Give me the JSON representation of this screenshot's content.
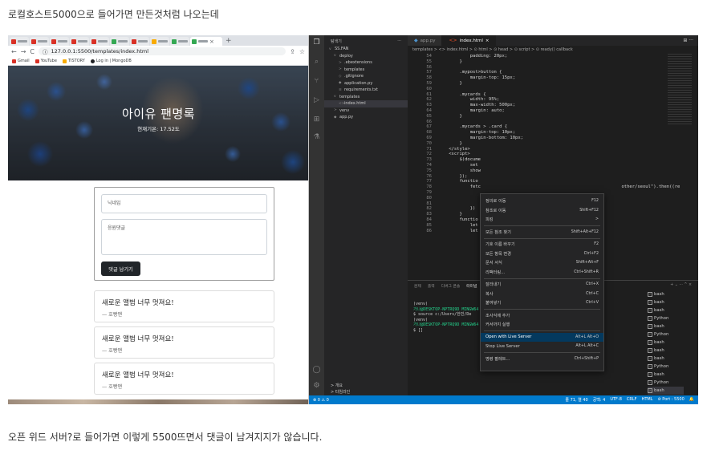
{
  "post": {
    "top_text": "로컬호스트5000으로 들어가면 만든것처럼 나오는데",
    "bottom_text": "오픈 위드 서버?로 들어가면 이렇게 5500뜨면서 댓글이 남겨지지가 않습니다."
  },
  "browser": {
    "tab_new": "+",
    "tab_close": "×",
    "url": "127.0.0.1:5500/templates/index.html",
    "nav": {
      "back": "←",
      "forward": "→",
      "reload": "C",
      "info": "ⓘ"
    },
    "bookmarks": [
      {
        "label": "Gmail",
        "icon": "red"
      },
      {
        "label": "YouTube",
        "icon": "red"
      },
      {
        "label": "TISTORY",
        "icon": "text"
      },
      {
        "label": "Log in | MongoDB",
        "icon": "black"
      }
    ],
    "page": {
      "title": "아이유 팬명록",
      "temperature": "현재기온: 17.52도",
      "name_placeholder": "닉네임",
      "comment_placeholder": "응원댓글",
      "submit_label": "댓글 남기기",
      "comments": [
        {
          "text": "새로운 앨범 너무 멋져요!",
          "author": "— 호빵맨"
        },
        {
          "text": "새로운 앨범 너무 멋져요!",
          "author": "— 호빵맨"
        },
        {
          "text": "새로운 앨범 너무 멋져요!",
          "author": "— 호빵맨"
        }
      ]
    }
  },
  "vscode": {
    "explorer_title": "탐색기",
    "explorer_more": "···",
    "tree": [
      {
        "label": "SS.FAN",
        "icon": "v",
        "indent": 0
      },
      {
        "label": "deploy",
        "icon": "v",
        "indent": 1
      },
      {
        "label": ".ebextensions",
        "icon": ">",
        "indent": 2
      },
      {
        "label": "templates",
        "icon": ">",
        "indent": 2
      },
      {
        "label": ".gitignore",
        "icon": "◇",
        "indent": 2
      },
      {
        "label": "application.py",
        "icon": "◆",
        "indent": 2
      },
      {
        "label": "requirements.txt",
        "icon": "≡",
        "indent": 2
      },
      {
        "label": "templates",
        "icon": "v",
        "indent": 1
      },
      {
        "label": "index.html",
        "icon": "<>",
        "indent": 2,
        "selected": true
      },
      {
        "label": "venv",
        "icon": ">",
        "indent": 1
      },
      {
        "label": "app.py",
        "icon": "◆",
        "indent": 1
      }
    ],
    "sidebar_bottom": [
      "> 개요",
      "> 타임라인"
    ],
    "tabs": [
      {
        "label": "app.py",
        "active": false
      },
      {
        "label": "index.html",
        "active": true
      }
    ],
    "tab_close": "×",
    "editor_actions": "⊞  ···",
    "breadcrumb": "templates > <> index.html > ⊙ html > ⊙ head > ⊙ script > ⊙ ready() callback",
    "code_lines": [
      {
        "n": "54",
        "t": "            padding: 20px;"
      },
      {
        "n": "55",
        "t": "        }"
      },
      {
        "n": "56",
        "t": ""
      },
      {
        "n": "57",
        "t": "        .mypost>button {"
      },
      {
        "n": "58",
        "t": "            margin-top: 15px;"
      },
      {
        "n": "59",
        "t": "        }"
      },
      {
        "n": "60",
        "t": ""
      },
      {
        "n": "61",
        "t": "        .mycards {"
      },
      {
        "n": "62",
        "t": "            width: 95%;"
      },
      {
        "n": "63",
        "t": "            max-width: 500px;"
      },
      {
        "n": "64",
        "t": "            margin: auto;"
      },
      {
        "n": "65",
        "t": "        }"
      },
      {
        "n": "66",
        "t": ""
      },
      {
        "n": "67",
        "t": "        .mycards > .card {"
      },
      {
        "n": "68",
        "t": "            margin-top: 10px;"
      },
      {
        "n": "69",
        "t": "            margin-bottom: 10px;"
      },
      {
        "n": "70",
        "t": "        }"
      },
      {
        "n": "71",
        "t": "    </style>"
      },
      {
        "n": "72",
        "t": "    <script>"
      },
      {
        "n": "73",
        "t": "        $(docume"
      },
      {
        "n": "74",
        "t": "            set"
      },
      {
        "n": "75",
        "t": "            show"
      },
      {
        "n": "76",
        "t": "        });"
      },
      {
        "n": "77",
        "t": "        functio"
      },
      {
        "n": "78",
        "t": "            fetc                                                     other/seoul\").then((re"
      },
      {
        "n": "79",
        "t": ""
      },
      {
        "n": "80",
        "t": ""
      },
      {
        "n": "81",
        "t": ""
      },
      {
        "n": "82",
        "t": "            })"
      },
      {
        "n": "83",
        "t": "        }"
      },
      {
        "n": "84",
        "t": "        functio"
      },
      {
        "n": "85",
        "t": "            let"
      },
      {
        "n": "86",
        "t": "            let"
      }
    ],
    "terminal_tabs": [
      "문제",
      "출력",
      "디버그 콘솔",
      "터미널"
    ],
    "terminal_actions": "+ ⌄  ···  ^  ×",
    "terminal_lines": [
      {
        "t": "(venv)",
        "green": false
      },
      {
        "t": "가나@DESKTOP-NPTRQ9D MINGW64",
        "green": true
      },
      {
        "t": "$ source c:/Users/한빈/De",
        "green": false
      },
      {
        "t": "(venv)",
        "green": false
      },
      {
        "t": "가나@DESKTOP-NPTRQ9D MINGW64",
        "green": true
      },
      {
        "t": "$ []",
        "green": false
      }
    ],
    "terminal_list": [
      {
        "label": "bash",
        "selected": false
      },
      {
        "label": "bash",
        "selected": false
      },
      {
        "label": "bash",
        "selected": false
      },
      {
        "label": "Python",
        "selected": false
      },
      {
        "label": "bash",
        "selected": false
      },
      {
        "label": "Python",
        "selected": false
      },
      {
        "label": "bash",
        "selected": false
      },
      {
        "label": "bash",
        "selected": false
      },
      {
        "label": "bash",
        "selected": false
      },
      {
        "label": "Python",
        "selected": false
      },
      {
        "label": "bash",
        "selected": false
      },
      {
        "label": "Python",
        "selected": false
      },
      {
        "label": "bash",
        "selected": true
      }
    ],
    "status_left": "⊗ 0 ⚠ 0",
    "status_right": [
      "줄 71, 열 40",
      "공백: 4",
      "UTF-8",
      "CRLF",
      "HTML",
      "⊘ Port : 5500",
      "🔔"
    ],
    "context_menu": [
      {
        "label": "정의로 이동",
        "key": "F12"
      },
      {
        "label": "참조로 이동",
        "key": "Shift+F12"
      },
      {
        "label": "피킹",
        "key": ">"
      },
      {
        "sep": true
      },
      {
        "label": "모든 참조 찾기",
        "key": "Shift+Alt+F12"
      },
      {
        "sep": true
      },
      {
        "label": "기호 이름 바꾸기",
        "key": "F2"
      },
      {
        "label": "모든 항목 변경",
        "key": "Ctrl+F2"
      },
      {
        "label": "문서 서식",
        "key": "Shift+Alt+F"
      },
      {
        "label": "리팩터링...",
        "key": "Ctrl+Shift+R"
      },
      {
        "sep": true
      },
      {
        "label": "잘라내기",
        "key": "Ctrl+X"
      },
      {
        "label": "복사",
        "key": "Ctrl+C"
      },
      {
        "label": "붙여넣기",
        "key": "Ctrl+V"
      },
      {
        "sep": true
      },
      {
        "label": "조사식에 추가",
        "key": ""
      },
      {
        "label": "커서까지 실행",
        "key": ""
      },
      {
        "sep": true
      },
      {
        "label": "Open with Live Server",
        "key": "Alt+L Alt+O",
        "highlight": true
      },
      {
        "label": "Stop Live Server",
        "key": "Alt+L Alt+C"
      },
      {
        "sep": true
      },
      {
        "label": "명령 팔레트...",
        "key": "Ctrl+Shift+P"
      }
    ]
  }
}
